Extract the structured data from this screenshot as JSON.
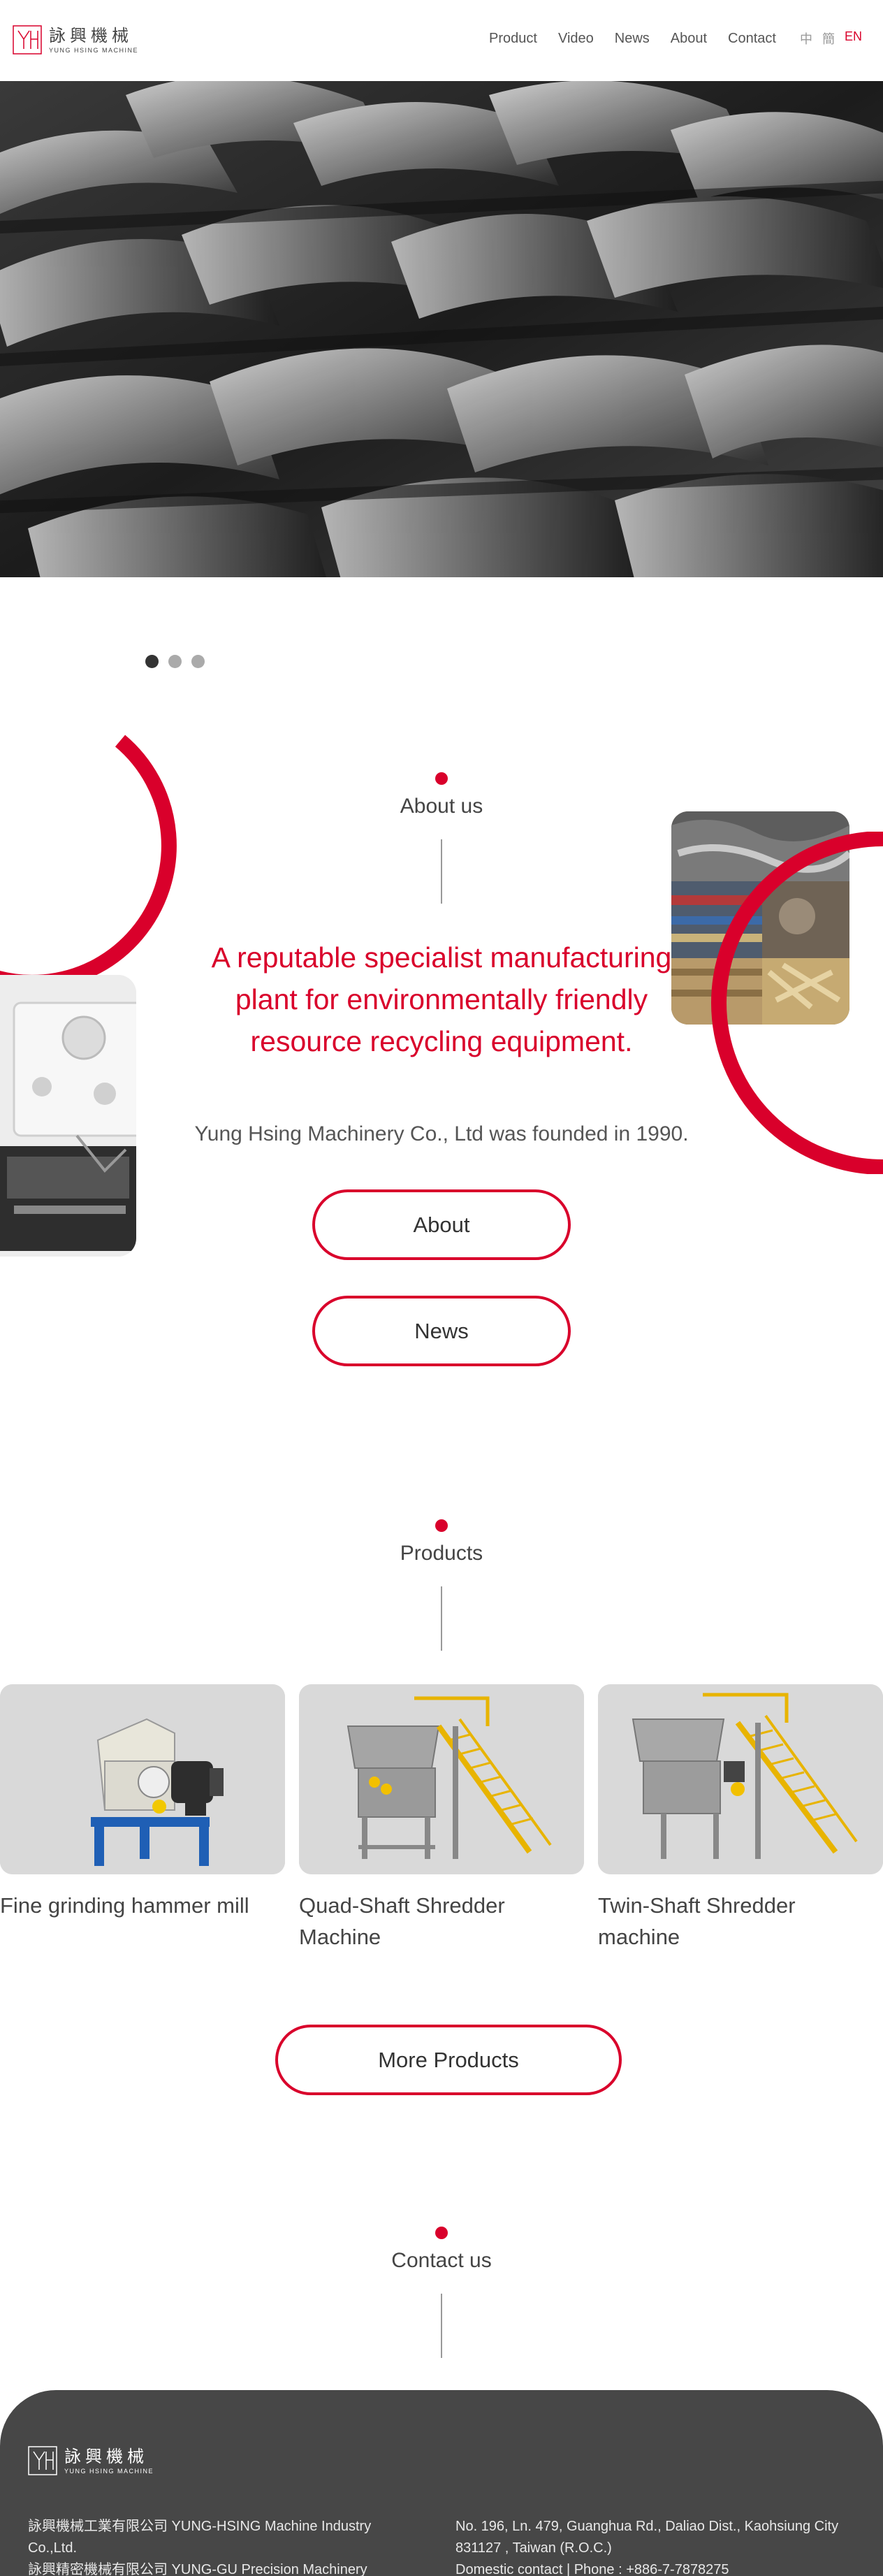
{
  "brand": {
    "name_cn": "詠興機械",
    "name_en": "YUNG HSING MACHINE"
  },
  "nav": {
    "items": [
      "Product",
      "Video",
      "News",
      "About",
      "Contact"
    ],
    "lang": [
      "中",
      "簡",
      "EN"
    ],
    "active_lang": "EN"
  },
  "hero": {
    "icon": "shredder-blades-photo",
    "slides": 3,
    "active_slide": 1
  },
  "about": {
    "section_label": "About us",
    "headline": "A reputable specialist manufacturing plant for environmentally friendly resource recycling equipment.",
    "subtext": "Yung Hsing Machinery Co., Ltd was founded in 1990.",
    "about_button": "About",
    "news_button": "News"
  },
  "products": {
    "section_label": "Products",
    "items": [
      {
        "name": "Fine grinding hammer mill"
      },
      {
        "name": "Quad-Shaft Shredder Machine"
      },
      {
        "name": "Twin-Shaft Shredder machine"
      }
    ],
    "more_button": "More Products"
  },
  "contact": {
    "section_label": "Contact us"
  },
  "footer": {
    "company_1": "詠興機械工業有限公司 YUNG-HSING Machine Industry Co.,Ltd.",
    "company_2": "詠興精密機械有限公司 YUNG-GU Precision Machinery Co.,Ltd.",
    "address": "No. 196, Ln. 479, Guanghua Rd., Daliao Dist., Kaohsiung City 831127 , Taiwan (R.O.C.)",
    "phone": "Domestic contact | Phone : +886-7-7878275"
  },
  "colors": {
    "accent": "#d9002b",
    "footer_bg": "#474747",
    "text": "#444444"
  }
}
